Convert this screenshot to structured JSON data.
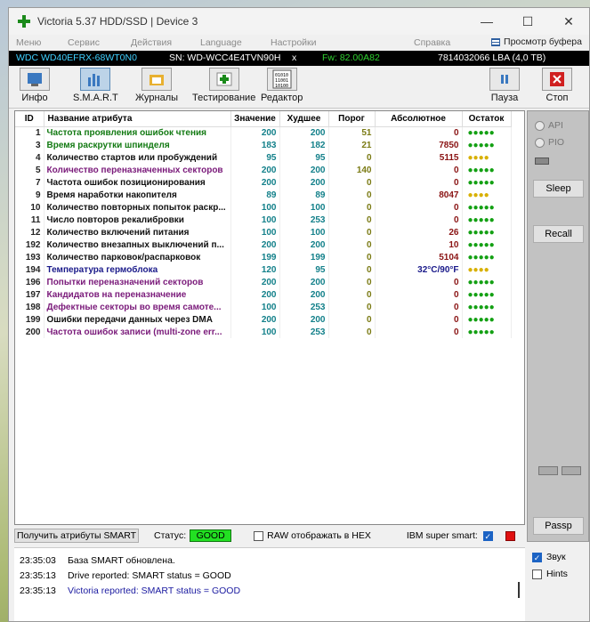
{
  "window": {
    "title": "Victoria 5.37 HDD/SSD | Device 3",
    "minimize": "—",
    "maximize": "☐",
    "close": "✕"
  },
  "menu": {
    "items": [
      "Меню",
      "Сервис",
      "Действия",
      "Language",
      "Настройки",
      "Справка"
    ],
    "buffer": "Просмотр буфера"
  },
  "device": {
    "model": "WDC WD40EFRX-68WT0N0",
    "serial": "SN: WD-WCC4E4TVN90H",
    "close": "x",
    "fw": "Fw: 82.00A82",
    "lba": "7814032066 LBA (4,0 TB)"
  },
  "toolbar": {
    "info": "Инфо",
    "smart": "S.M.A.R.T",
    "logs": "Журналы",
    "testing": "Тестирование",
    "editor": "Редактор",
    "pause": "Пауза",
    "stop": "Стоп"
  },
  "table": {
    "headers": [
      "ID",
      "Название атрибута",
      "Значение",
      "Худшее",
      "Порог",
      "Абсолютное",
      "Остаток"
    ],
    "rows": [
      {
        "id": "1",
        "name": "Частота проявления ошибок чтения",
        "value": "200",
        "worst": "200",
        "thr": "51",
        "abs": "0",
        "color": "g",
        "dots": "●●●●●",
        "dc": "g"
      },
      {
        "id": "3",
        "name": "Время раскрутки шпинделя",
        "value": "183",
        "worst": "182",
        "thr": "21",
        "abs": "7850",
        "color": "g",
        "dots": "●●●●●",
        "dc": "g"
      },
      {
        "id": "4",
        "name": "Количество стартов или пробуждений",
        "value": "95",
        "worst": "95",
        "thr": "0",
        "abs": "5115",
        "color": "k",
        "dots": "●●●●",
        "dc": "y"
      },
      {
        "id": "5",
        "name": "Количество переназначенных секторов",
        "value": "200",
        "worst": "200",
        "thr": "140",
        "abs": "0",
        "color": "p",
        "dots": "●●●●●",
        "dc": "g"
      },
      {
        "id": "7",
        "name": "Частота ошибок позиционирования",
        "value": "200",
        "worst": "200",
        "thr": "0",
        "abs": "0",
        "color": "k",
        "dots": "●●●●●",
        "dc": "g"
      },
      {
        "id": "9",
        "name": "Время наработки накопителя",
        "value": "89",
        "worst": "89",
        "thr": "0",
        "abs": "8047",
        "color": "k",
        "dots": "●●●●",
        "dc": "y"
      },
      {
        "id": "10",
        "name": "Количество повторных попыток раскр...",
        "value": "100",
        "worst": "100",
        "thr": "0",
        "abs": "0",
        "color": "k",
        "dots": "●●●●●",
        "dc": "g"
      },
      {
        "id": "11",
        "name": "Число повторов рекалибровки",
        "value": "100",
        "worst": "253",
        "thr": "0",
        "abs": "0",
        "color": "k",
        "dots": "●●●●●",
        "dc": "g"
      },
      {
        "id": "12",
        "name": "Количество включений питания",
        "value": "100",
        "worst": "100",
        "thr": "0",
        "abs": "26",
        "color": "k",
        "dots": "●●●●●",
        "dc": "g"
      },
      {
        "id": "192",
        "name": "Количество внезапных выключений п...",
        "value": "200",
        "worst": "200",
        "thr": "0",
        "abs": "10",
        "color": "k",
        "dots": "●●●●●",
        "dc": "g"
      },
      {
        "id": "193",
        "name": "Количество парковок/распарковок",
        "value": "199",
        "worst": "199",
        "thr": "0",
        "abs": "5104",
        "color": "k",
        "dots": "●●●●●",
        "dc": "g"
      },
      {
        "id": "194",
        "name": "Температура гермоблока",
        "value": "120",
        "worst": "95",
        "thr": "0",
        "abs": "32°C/90°F",
        "color": "b",
        "dots": "●●●●",
        "dc": "y"
      },
      {
        "id": "196",
        "name": "Попытки переназначений секторов",
        "value": "200",
        "worst": "200",
        "thr": "0",
        "abs": "0",
        "color": "p",
        "dots": "●●●●●",
        "dc": "g"
      },
      {
        "id": "197",
        "name": "Кандидатов на переназначение",
        "value": "200",
        "worst": "200",
        "thr": "0",
        "abs": "0",
        "color": "p",
        "dots": "●●●●●",
        "dc": "g"
      },
      {
        "id": "198",
        "name": "Дефектные секторы во время самоте...",
        "value": "100",
        "worst": "253",
        "thr": "0",
        "abs": "0",
        "color": "p",
        "dots": "●●●●●",
        "dc": "g"
      },
      {
        "id": "199",
        "name": "Ошибки передачи данных через DMA",
        "value": "200",
        "worst": "200",
        "thr": "0",
        "abs": "0",
        "color": "k",
        "dots": "●●●●●",
        "dc": "g"
      },
      {
        "id": "200",
        "name": "Частота ошибок записи (multi-zone err...",
        "value": "100",
        "worst": "253",
        "thr": "0",
        "abs": "0",
        "color": "p",
        "dots": "●●●●●",
        "dc": "g"
      }
    ]
  },
  "status": {
    "get_button": "Получить атрибуты SMART",
    "label": "Статус:",
    "value": "GOOD",
    "raw_hex": "RAW отображать в HEX",
    "ibm": "IBM super smart:"
  },
  "log": [
    {
      "time": "23:35:03",
      "msg": "База SMART обновлена.",
      "color": "#000"
    },
    {
      "time": "23:35:13",
      "msg": "Drive reported: SMART status = GOOD",
      "color": "#000"
    },
    {
      "time": "23:35:13",
      "msg": "Victoria reported: SMART status = GOOD",
      "color": "#1a1aa0"
    }
  ],
  "side": {
    "api": "API",
    "pio": "PIO",
    "sleep": "Sleep",
    "recall": "Recall",
    "passp": "Passp",
    "sound": "Звук",
    "hints": "Hints"
  }
}
